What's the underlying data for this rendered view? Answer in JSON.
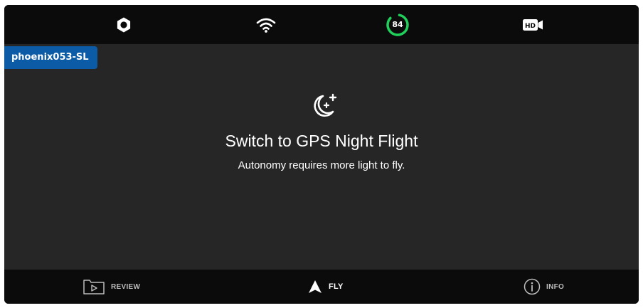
{
  "topbar": {
    "icons": {
      "settings": "gear-icon",
      "wifi": "wifi-icon",
      "battery": "battery-ring-icon",
      "video": "hd-camera-icon"
    },
    "battery_percent": "84",
    "battery_color": "#1fd15a"
  },
  "drone": {
    "name": "phoenix053-SL",
    "tag_color": "#0c5ba6"
  },
  "notice": {
    "icon": "moon-stars-icon",
    "title": "Switch to GPS Night Flight",
    "subtitle": "Autonomy requires more light to fly."
  },
  "nav": {
    "items": [
      {
        "label": "REVIEW",
        "icon": "review-folder-icon"
      },
      {
        "label": "FLY",
        "icon": "fly-arrow-icon"
      },
      {
        "label": "INFO",
        "icon": "info-icon"
      }
    ]
  }
}
